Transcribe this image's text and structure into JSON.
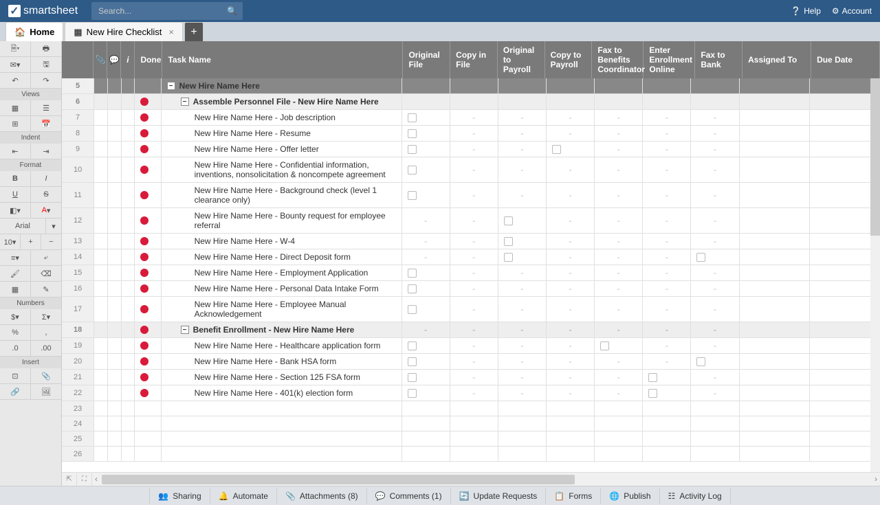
{
  "app": {
    "name": "smartsheet",
    "search_placeholder": "Search...",
    "help": "Help",
    "account": "Account"
  },
  "tabs": {
    "home": "Home",
    "doc": "New Hire Checklist"
  },
  "sidebar": {
    "views": "Views",
    "indent": "Indent",
    "format": "Format",
    "font": "Arial",
    "numbers": "Numbers",
    "insert": "Insert"
  },
  "columns": {
    "done": "Done",
    "task": "Task Name",
    "c1": "Original File",
    "c2": "Copy in File",
    "c3": "Original to Payroll",
    "c4": "Copy to Payroll",
    "c5": "Fax to Benefits Coordinator",
    "c6": "Enter Enrollment Online",
    "c7": "Fax to Bank",
    "c8": "Assigned To",
    "c9": "Due Date"
  },
  "rows": [
    {
      "n": 5,
      "type": "group",
      "task": "New Hire Name Here"
    },
    {
      "n": 6,
      "type": "section",
      "task": "Assemble Personnel File - New Hire Name Here",
      "dot": true
    },
    {
      "n": 7,
      "task": "New Hire Name Here - Job description",
      "dot": true,
      "c1": "check",
      "c2": "-",
      "c3": "-",
      "c4": "-",
      "c5": "-",
      "c6": "-",
      "c7": "-"
    },
    {
      "n": 8,
      "task": "New Hire Name Here - Resume",
      "dot": true,
      "c1": "check",
      "c2": "-",
      "c3": "-",
      "c4": "-",
      "c5": "-",
      "c6": "-",
      "c7": "-"
    },
    {
      "n": 9,
      "task": "New Hire Name Here - Offer letter",
      "dot": true,
      "c1": "check",
      "c2": "-",
      "c3": "-",
      "c4": "check",
      "c5": "-",
      "c6": "-",
      "c7": "-"
    },
    {
      "n": 10,
      "task": "New Hire Name Here - Confidential information, inventions, nonsolicitation & noncompete agreement",
      "dot": true,
      "c1": "check",
      "c2": "-",
      "c3": "-",
      "c4": "-",
      "c5": "-",
      "c6": "-",
      "c7": "-"
    },
    {
      "n": 11,
      "task": "New Hire Name Here - Background check (level 1 clearance only)",
      "dot": true,
      "c1": "check",
      "c2": "-",
      "c3": "-",
      "c4": "-",
      "c5": "-",
      "c6": "-",
      "c7": "-"
    },
    {
      "n": 12,
      "task": "New Hire Name Here - Bounty request for employee referral",
      "dot": true,
      "c1": "-",
      "c2": "-",
      "c3": "check",
      "c4": "-",
      "c5": "-",
      "c6": "-",
      "c7": "-"
    },
    {
      "n": 13,
      "task": "New Hire Name Here - W-4",
      "dot": true,
      "c1": "-",
      "c2": "-",
      "c3": "check",
      "c4": "-",
      "c5": "-",
      "c6": "-",
      "c7": "-"
    },
    {
      "n": 14,
      "task": "New Hire Name Here - Direct Deposit form",
      "dot": true,
      "c1": "-",
      "c2": "-",
      "c3": "check",
      "c4": "-",
      "c5": "-",
      "c6": "-",
      "c7": "check"
    },
    {
      "n": 15,
      "task": "New Hire Name Here - Employment Application",
      "dot": true,
      "c1": "check",
      "c2": "-",
      "c3": "-",
      "c4": "-",
      "c5": "-",
      "c6": "-",
      "c7": "-"
    },
    {
      "n": 16,
      "task": "New Hire Name Here - Personal Data Intake Form",
      "dot": true,
      "c1": "check",
      "c2": "-",
      "c3": "-",
      "c4": "-",
      "c5": "-",
      "c6": "-",
      "c7": "-"
    },
    {
      "n": 17,
      "task": "New Hire Name Here - Employee Manual Acknowledgement",
      "dot": true,
      "c1": "check",
      "c2": "-",
      "c3": "-",
      "c4": "-",
      "c5": "-",
      "c6": "-",
      "c7": "-"
    },
    {
      "n": 18,
      "type": "section",
      "task": "Benefit Enrollment - New Hire Name Here",
      "dot": true,
      "c1": "-",
      "c2": "-",
      "c3": "-",
      "c4": "-",
      "c5": "-",
      "c6": "-",
      "c7": "-"
    },
    {
      "n": 19,
      "task": "New Hire Name Here - Healthcare application form",
      "dot": true,
      "c1": "check",
      "c2": "-",
      "c3": "-",
      "c4": "-",
      "c5": "check",
      "c6": "-",
      "c7": "-"
    },
    {
      "n": 20,
      "task": "New Hire Name Here - Bank HSA form",
      "dot": true,
      "c1": "check",
      "c2": "-",
      "c3": "-",
      "c4": "-",
      "c5": "-",
      "c6": "-",
      "c7": "check"
    },
    {
      "n": 21,
      "task": "New Hire Name Here - Section 125 FSA form",
      "dot": true,
      "c1": "check",
      "c2": "-",
      "c3": "-",
      "c4": "-",
      "c5": "-",
      "c6": "check",
      "c7": "-"
    },
    {
      "n": 22,
      "task": "New Hire Name Here - 401(k) election form",
      "dot": true,
      "c1": "check",
      "c2": "-",
      "c3": "-",
      "c4": "-",
      "c5": "-",
      "c6": "check",
      "c7": "-"
    },
    {
      "n": 23
    },
    {
      "n": 24
    },
    {
      "n": 25
    },
    {
      "n": 26
    }
  ],
  "footer": {
    "sharing": "Sharing",
    "automate": "Automate",
    "attachments": "Attachments (8)",
    "comments": "Comments (1)",
    "update": "Update Requests",
    "forms": "Forms",
    "publish": "Publish",
    "activity": "Activity Log"
  }
}
